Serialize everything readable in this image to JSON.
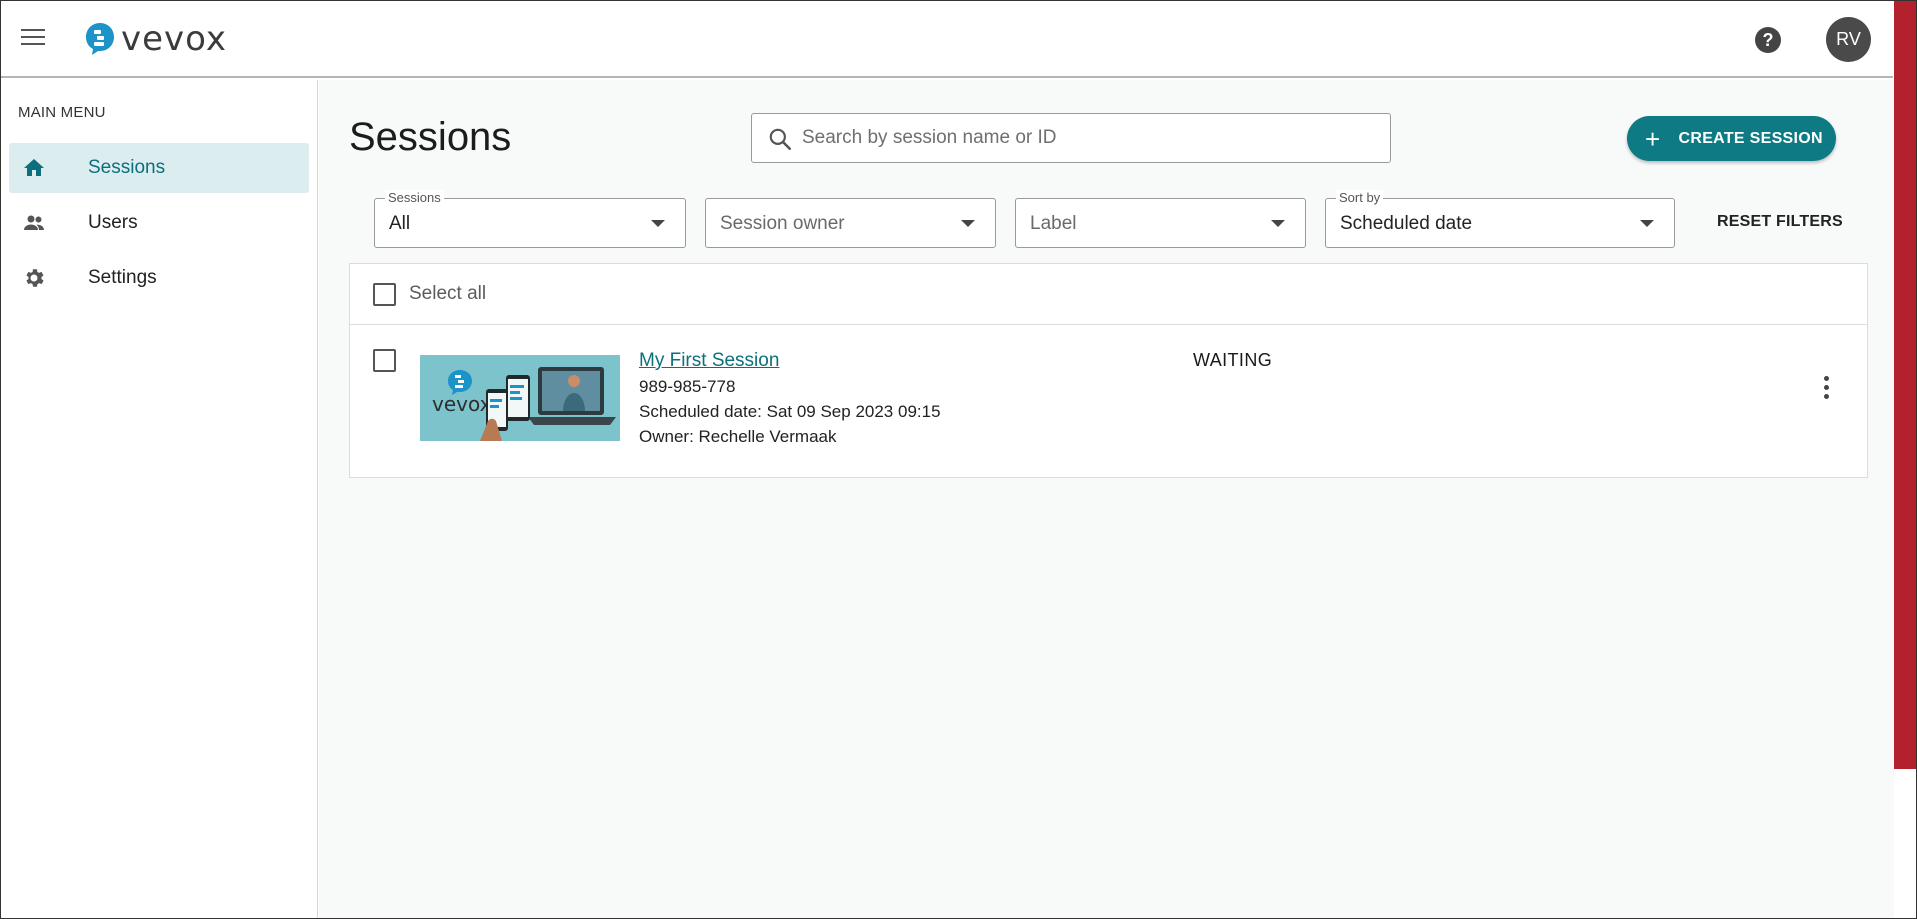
{
  "header": {
    "logo_text": "vevox",
    "help_icon": "help-circle-icon",
    "avatar_initials": "RV"
  },
  "sidebar": {
    "title": "MAIN MENU",
    "items": [
      {
        "label": "Sessions",
        "icon": "home-icon",
        "active": true
      },
      {
        "label": "Users",
        "icon": "users-icon",
        "active": false
      },
      {
        "label": "Settings",
        "icon": "gear-icon",
        "active": false
      }
    ]
  },
  "main": {
    "title": "Sessions",
    "search": {
      "placeholder": "Search by session name or ID",
      "value": ""
    },
    "create_button": {
      "label": "CREATE SESSION"
    },
    "filters": [
      {
        "label": "Sessions",
        "value": "All"
      },
      {
        "label": "",
        "value": "Session owner"
      },
      {
        "label": "",
        "value": "Label"
      },
      {
        "label": "Sort by",
        "value": "Scheduled date"
      }
    ],
    "reset_filters": "RESET FILTERS",
    "select_all": "Select all",
    "sessions": [
      {
        "name": "My First Session",
        "id": "989-985-778",
        "scheduled": "Scheduled date: Sat 09 Sep 2023 09:15",
        "owner": "Owner: Rechelle Vermaak",
        "status": "WAITING",
        "thumbnail_text": "vevox"
      }
    ]
  },
  "colors": {
    "accent": "#0e7a83",
    "active_nav_bg": "#dcedf0",
    "scroll_thumb": "#b4212e"
  }
}
